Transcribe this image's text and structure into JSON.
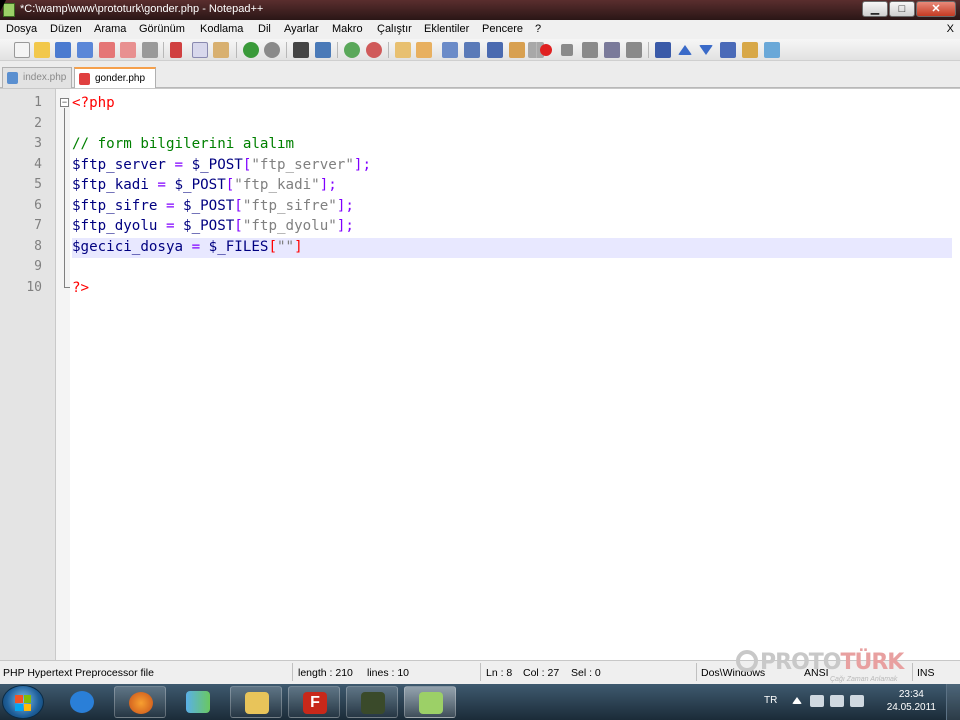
{
  "window": {
    "title": "*C:\\wamp\\www\\prototurk\\gonder.php - Notepad++",
    "controls": {
      "minimize": "▁",
      "maximize": "□",
      "close": "✕"
    }
  },
  "menu": {
    "items": [
      "Dosya",
      "Düzen",
      "Arama",
      "Görünüm",
      "Kodlama",
      "Dil",
      "Ayarlar",
      "Makro",
      "Çalıştır",
      "Eklentiler",
      "Pencere",
      "?"
    ],
    "close_doc": "X"
  },
  "toolbar": {
    "icons": [
      "new-file-icon",
      "open-file-icon",
      "save-icon",
      "save-all-icon",
      "close-icon",
      "close-all-icon",
      "print-icon",
      "cut-icon",
      "copy-icon",
      "paste-icon",
      "undo-icon",
      "redo-icon",
      "find-icon",
      "replace-icon",
      "zoom-in-icon",
      "zoom-out-icon",
      "sync-v-icon",
      "sync-h-icon",
      "word-wrap-icon",
      "show-all-chars-icon",
      "indent-guide-icon",
      "doc-map-icon",
      "function-list-icon",
      "macro-record-icon",
      "macro-stop-icon",
      "macro-play-icon",
      "macro-play-multi-icon",
      "macro-save-icon",
      "collapse-icon",
      "up-icon",
      "down-icon",
      "bookmark-icon",
      "plugin-icon",
      "spellcheck-icon"
    ]
  },
  "tabs": [
    {
      "label": "index.php",
      "active": false
    },
    {
      "label": "gonder.php",
      "active": true
    }
  ],
  "editor": {
    "line_numbers": [
      "1",
      "2",
      "3",
      "4",
      "5",
      "6",
      "7",
      "8",
      "9",
      "10"
    ],
    "lines": {
      "l1": {
        "open": "<?php"
      },
      "l3": {
        "comment": "// form bilgilerini alalım"
      },
      "l4": {
        "var": "$ftp_server",
        "eq": " = ",
        "sg": "$_POST",
        "lb": "[",
        "str": "\"ftp_server\"",
        "rb": "]",
        "semi": ";"
      },
      "l5": {
        "var": "$ftp_kadi",
        "eq": " = ",
        "sg": "$_POST",
        "lb": "[",
        "str": "\"ftp_kadi\"",
        "rb": "]",
        "semi": ";"
      },
      "l6": {
        "var": "$ftp_sifre",
        "eq": " = ",
        "sg": "$_POST",
        "lb": "[",
        "str": "\"ftp_sifre\"",
        "rb": "]",
        "semi": ";"
      },
      "l7": {
        "var": "$ftp_dyolu",
        "eq": " = ",
        "sg": "$_POST",
        "lb": "[",
        "str": "\"ftp_dyolu\"",
        "rb": "]",
        "semi": ";"
      },
      "l8": {
        "var": "$gecici_dosya",
        "eq": " = ",
        "sg": "$_FILES",
        "lb": "[",
        "str": "\"\"",
        "rb": "]"
      },
      "l10": {
        "close": "?>"
      }
    }
  },
  "status": {
    "filetype": "PHP Hypertext Preprocessor file",
    "length": "length : 210",
    "lines": "lines : 10",
    "ln": "Ln : 8",
    "col": "Col : 27",
    "sel": "Sel : 0",
    "eol": "Dos\\Windows",
    "encoding": "ANSI",
    "mode": "INS"
  },
  "watermark": {
    "brand_a": "PROTO",
    "brand_b": "TÜRK",
    "tagline": "Çağı Zaman Anlamak"
  },
  "taskbar": {
    "apps": [
      "internet-explorer",
      "firefox",
      "messenger",
      "explorer",
      "filezilla",
      "wamp",
      "notepad-plus-plus"
    ],
    "tray": {
      "language": "TR",
      "time": "23:34",
      "date": "24.05.2011"
    }
  }
}
